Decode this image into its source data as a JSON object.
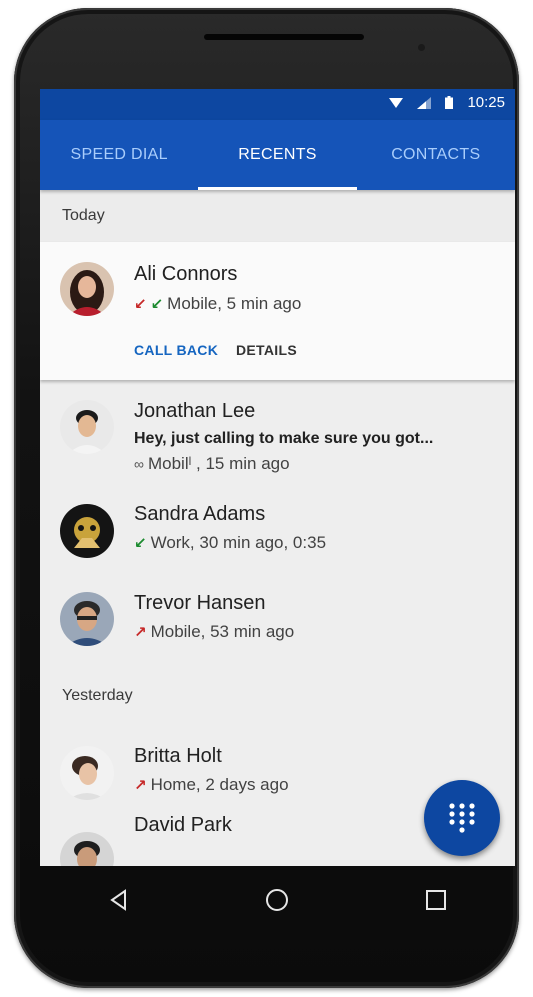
{
  "status_bar": {
    "time": "10:25"
  },
  "tabs": [
    {
      "label": "SPEED DIAL"
    },
    {
      "label": "RECENTS"
    },
    {
      "label": "CONTACTS"
    }
  ],
  "sections": {
    "today": "Today",
    "yesterday": "Yesterday"
  },
  "calls": [
    {
      "name": "Ali Connors",
      "detail": "Mobile, 5 min ago",
      "call_type": "missed-incoming",
      "actions": {
        "call_back": "CALL BACK",
        "details": "DETAILS"
      }
    },
    {
      "name": "Jonathan Lee",
      "message": "Hey, just calling to make sure you got...",
      "detail": "Mobilˡ , 15 min ago",
      "call_type": "voicemail"
    },
    {
      "name": "Sandra Adams",
      "detail": "Work, 30 min ago, 0:35",
      "call_type": "incoming"
    },
    {
      "name": "Trevor Hansen",
      "detail": "Mobile, 53 min ago",
      "call_type": "outgoing"
    },
    {
      "name": "Britta Holt",
      "detail": "Home, 2 days ago",
      "call_type": "outgoing"
    },
    {
      "name": "David Park"
    }
  ],
  "colors": {
    "status_bar": "#0d47a1",
    "tab_bar": "#1554b8",
    "inactive_tab": "#a9cdfb",
    "accent": "#1565c0",
    "incoming": "#1b8a2e",
    "missed": "#c62828",
    "fab": "#0d47a1"
  },
  "icons": {
    "fab": "dialpad-icon",
    "nav": [
      "back-icon",
      "home-icon",
      "recents-icon"
    ]
  }
}
